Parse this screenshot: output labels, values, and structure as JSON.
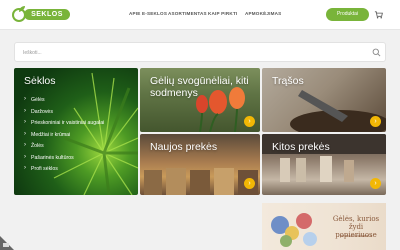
{
  "brand": {
    "logo_text": "SEKLOS",
    "accent": "#79b43a"
  },
  "nav": {
    "items": [
      "APIE E-SEKLOS",
      "ASORTIMENTAS",
      "KAIP PIRKTI",
      "APMOKĖJIMAS"
    ],
    "cta_label": "Produktai",
    "cart_icon": "cart-icon"
  },
  "search": {
    "placeholder": "Ieškoti...",
    "value": "",
    "icon": "search-icon"
  },
  "tiles": {
    "seklos": {
      "title": "Sėklos",
      "categories": [
        "Gėlės",
        "Daržovės",
        "Prieskoniniai ir vaistiniai augalai",
        "Medžiai ir krūmai",
        "Žolės",
        "Pašarinės kultūros",
        "Profi sėklos"
      ]
    },
    "bulbs": {
      "title_line1": "Gėlių svogūnėliai, kiti",
      "title_line2": "sodmenys"
    },
    "fertilizer": {
      "title": "Trąšos"
    },
    "new": {
      "title": "Naujos prekės"
    },
    "other": {
      "title": "Kitos prekės"
    }
  },
  "ad": {
    "title": "Gėlės, kurios žydi popieriuose",
    "url": "peleduodiinbuve.lt"
  },
  "colors": {
    "arrow": "#f2b705",
    "page_bg": "#f1f1f1"
  }
}
